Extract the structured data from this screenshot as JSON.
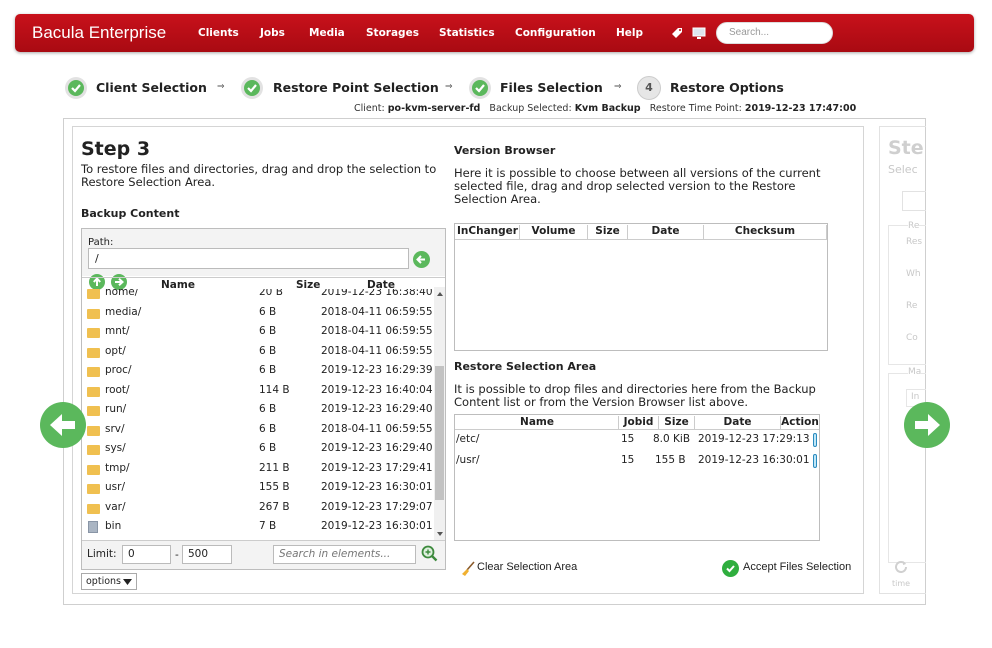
{
  "nav": {
    "brand": "Bacula Enterprise",
    "menu": [
      "Clients",
      "Jobs",
      "Media",
      "Storages",
      "Statistics",
      "Configuration",
      "Help"
    ],
    "search_placeholder": "Search..."
  },
  "wizard": {
    "steps": [
      {
        "label": "Client Selection",
        "state": "done"
      },
      {
        "label": "Restore Point Selection",
        "state": "done"
      },
      {
        "label": "Files Selection",
        "state": "done"
      },
      {
        "label": "Restore Options",
        "state": "pending",
        "number": "4"
      }
    ],
    "arrow": "⇒",
    "info": {
      "client_label": "Client:",
      "client_value": "po-kvm-server-fd",
      "backup_label": "Backup Selected:",
      "backup_value": "Kvm Backup",
      "time_label": "Restore Time Point:",
      "time_value": "2019-12-23 17:47:00"
    }
  },
  "step3": {
    "title": "Step 3",
    "description": "To restore files and directories, drag and drop the selection to Restore Selection Area.",
    "backup_content": {
      "title": "Backup Content",
      "path_label": "Path:",
      "path_value": "/",
      "columns": {
        "name": "Name",
        "size": "Size",
        "date": "Date"
      },
      "files": [
        {
          "name": "home/",
          "size": "20 B",
          "date": "2019-12-23 16:38:40",
          "type": "folder"
        },
        {
          "name": "media/",
          "size": "6 B",
          "date": "2018-04-11 06:59:55",
          "type": "folder"
        },
        {
          "name": "mnt/",
          "size": "6 B",
          "date": "2018-04-11 06:59:55",
          "type": "folder"
        },
        {
          "name": "opt/",
          "size": "6 B",
          "date": "2018-04-11 06:59:55",
          "type": "folder"
        },
        {
          "name": "proc/",
          "size": "6 B",
          "date": "2019-12-23 16:29:39",
          "type": "folder"
        },
        {
          "name": "root/",
          "size": "114 B",
          "date": "2019-12-23 16:40:04",
          "type": "folder"
        },
        {
          "name": "run/",
          "size": "6 B",
          "date": "2019-12-23 16:29:40",
          "type": "folder"
        },
        {
          "name": "srv/",
          "size": "6 B",
          "date": "2018-04-11 06:59:55",
          "type": "folder"
        },
        {
          "name": "sys/",
          "size": "6 B",
          "date": "2019-12-23 16:29:40",
          "type": "folder"
        },
        {
          "name": "tmp/",
          "size": "211 B",
          "date": "2019-12-23 17:29:41",
          "type": "folder"
        },
        {
          "name": "usr/",
          "size": "155 B",
          "date": "2019-12-23 16:30:01",
          "type": "folder"
        },
        {
          "name": "var/",
          "size": "267 B",
          "date": "2019-12-23 17:29:07",
          "type": "folder"
        },
        {
          "name": "bin",
          "size": "7 B",
          "date": "2019-12-23 16:30:01",
          "type": "file"
        }
      ],
      "limit_label": "Limit:",
      "limit_from": "0",
      "limit_sep": "-",
      "limit_to": "500",
      "search_placeholder": "Search in elements...",
      "options_label": "options"
    },
    "version_browser": {
      "title": "Version Browser",
      "description": "Here it is possible to choose between all versions of the current selected file, drag and drop selected version to the Restore Selection Area.",
      "columns": [
        "InChanger",
        "Volume",
        "Size",
        "Date",
        "Checksum"
      ]
    },
    "restore_area": {
      "title": "Restore Selection Area",
      "description": "It is possible to drop files and directories here from the Backup Content list or from the Version Browser list above.",
      "columns": [
        "Name",
        "Jobid",
        "Size",
        "Date",
        "Action"
      ],
      "rows": [
        {
          "name": "/etc/",
          "jobid": "15",
          "size": "8.0 KiB",
          "date": "2019-12-23 17:29:13"
        },
        {
          "name": "/usr/",
          "jobid": "15",
          "size": "155 B",
          "date": "2019-12-23 16:30:01"
        }
      ]
    },
    "clear_label": "Clear Selection Area",
    "accept_label": "Accept Files Selection"
  },
  "next_panel": {
    "title": "Ste",
    "subtitle": "Selec",
    "partial": [
      "Re",
      "Res",
      "Wh",
      "Re",
      "Co",
      "Ma",
      "In",
      "time"
    ]
  },
  "colors": {
    "brand_red": "#b80d16",
    "success_green": "#5bb85c"
  }
}
